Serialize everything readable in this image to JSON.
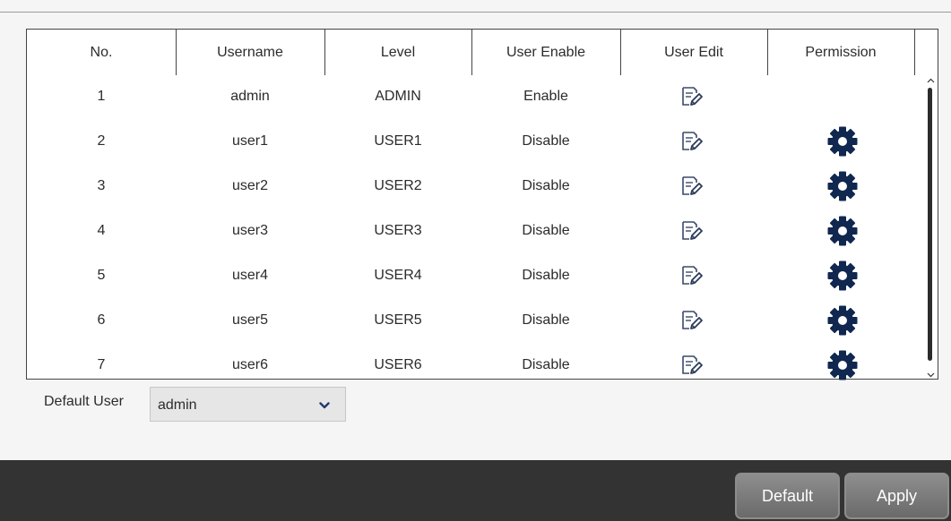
{
  "table": {
    "headers": {
      "no": "No.",
      "username": "Username",
      "level": "Level",
      "user_enable": "User Enable",
      "user_edit": "User Edit",
      "permission": "Permission"
    },
    "rows": [
      {
        "no": "1",
        "username": "admin",
        "level": "ADMIN",
        "user_enable": "Enable",
        "has_permission": false
      },
      {
        "no": "2",
        "username": "user1",
        "level": "USER1",
        "user_enable": "Disable",
        "has_permission": true
      },
      {
        "no": "3",
        "username": "user2",
        "level": "USER2",
        "user_enable": "Disable",
        "has_permission": true
      },
      {
        "no": "4",
        "username": "user3",
        "level": "USER3",
        "user_enable": "Disable",
        "has_permission": true
      },
      {
        "no": "5",
        "username": "user4",
        "level": "USER4",
        "user_enable": "Disable",
        "has_permission": true
      },
      {
        "no": "6",
        "username": "user5",
        "level": "USER5",
        "user_enable": "Disable",
        "has_permission": true
      },
      {
        "no": "7",
        "username": "user6",
        "level": "USER6",
        "user_enable": "Disable",
        "has_permission": true
      }
    ],
    "edit_icon": "edit-icon",
    "permission_icon": "gear-icon"
  },
  "default_user": {
    "label": "Default User",
    "value": "admin"
  },
  "buttons": {
    "default": "Default",
    "apply": "Apply"
  },
  "colors": {
    "gear": "#10274f",
    "footer": "#333333"
  }
}
